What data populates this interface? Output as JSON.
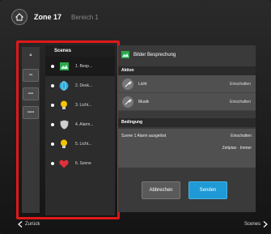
{
  "topbar": {
    "zone": "Zone 17",
    "area": "Bereich 1"
  },
  "rail": {
    "arrow": "▲",
    "btn1": "▪▪",
    "btn2": "▪▪▪",
    "btn3": "▪▪▪▪"
  },
  "scenes": {
    "header": "Scenes",
    "items": [
      {
        "label": "1. Besp...",
        "icon": "picture-icon"
      },
      {
        "label": "2. Desk...",
        "icon": "globe-icon"
      },
      {
        "label": "3. Licht...",
        "icon": "bulb-icon"
      },
      {
        "label": "4. Alarm...",
        "icon": "shield-icon"
      },
      {
        "label": "5. Licht...",
        "icon": "bulb-icon"
      },
      {
        "label": "6. Szene",
        "icon": "heart-icon"
      }
    ]
  },
  "detail": {
    "title": "Bilder Besprechung",
    "actions_head": "Aktion",
    "actions": [
      {
        "name": "Licht",
        "value": "Einschalten"
      },
      {
        "name": "Musik",
        "value": "Einschalten"
      }
    ],
    "condition_head": "Bedingung",
    "condition_text": "Szene 1 Alarm ausgelöst",
    "condition_val1": "Einschalten",
    "condition_val2": "Zeitplan · Immer"
  },
  "buttons": {
    "cancel": "Abbrechen",
    "save": "Senden"
  },
  "footer": {
    "back": "Zurück",
    "next": "Scenes"
  },
  "colors": {
    "accent": "#1f9ad6",
    "highlight": "#e01818"
  }
}
